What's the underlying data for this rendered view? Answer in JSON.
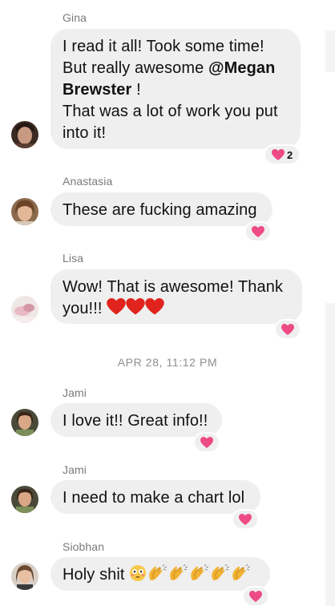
{
  "messages": [
    {
      "sender": "Gina",
      "text_parts": [
        "I read it all! Took some time!",
        "But really awesome ",
        "@Megan Brewster",
        " !",
        "That was a lot of work you put into it!"
      ],
      "reaction": {
        "icon": "heart-icon",
        "count": "2"
      }
    },
    {
      "sender": "Anastasia",
      "text": "These are fucking amazing",
      "reaction": {
        "icon": "heart-icon"
      }
    },
    {
      "sender": "Lisa",
      "text_line1": "Wow! That is awesome! Thank",
      "text_line2": "you!!!",
      "inline_emoji": [
        "red-heart-icon",
        "red-heart-icon",
        "red-heart-icon"
      ],
      "reaction": {
        "icon": "heart-icon"
      }
    },
    {
      "sender": "Jami",
      "text": "I love it!! Great info!!",
      "reaction": {
        "icon": "heart-icon"
      }
    },
    {
      "sender": "Jami",
      "text": "I need to make a chart lol",
      "reaction": {
        "icon": "heart-icon"
      }
    },
    {
      "sender": "Siobhan",
      "text": "Holy shit",
      "inline_emoji": [
        "flushed-face-icon",
        "clapping-hands-icon",
        "clapping-hands-icon",
        "clapping-hands-icon",
        "clapping-hands-icon",
        "clapping-hands-icon"
      ],
      "reaction": {
        "icon": "heart-icon"
      }
    }
  ],
  "timestamp": "APR 28, 11:12 PM",
  "colors": {
    "bubble": "#efefef",
    "heart_pink": "#ee4b86",
    "heart_red": "#e0241d",
    "sender_gray": "#7a7a7a"
  }
}
